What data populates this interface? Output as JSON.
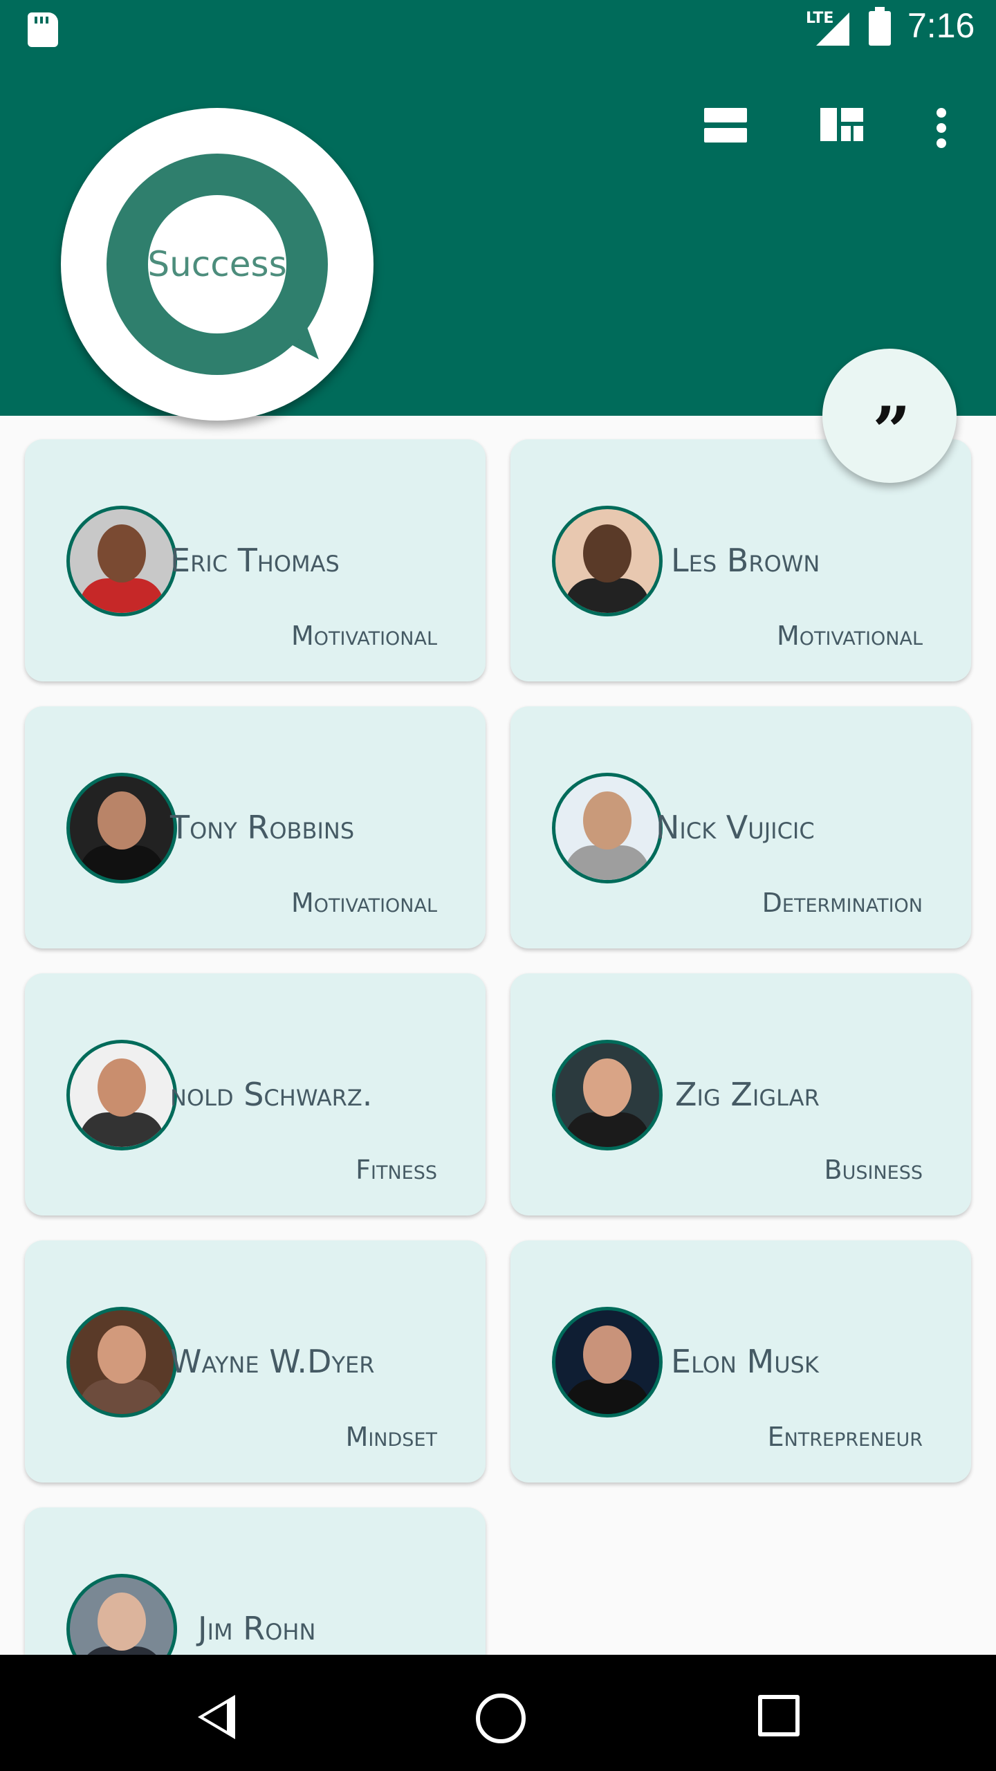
{
  "status_bar": {
    "network": "LTE",
    "time": "7:16",
    "icons": [
      "sd-card-icon",
      "signal-icon",
      "battery-charging-icon"
    ]
  },
  "app_bar": {
    "logo_text": "Success",
    "actions": [
      "list-view-icon",
      "grid-view-icon",
      "more-options-icon"
    ]
  },
  "fab": {
    "icon": "quote-icon",
    "glyph": "❞"
  },
  "colors": {
    "primary": "#006b5a",
    "card": "#e0f2f1",
    "text": "#455a64"
  },
  "speakers": [
    {
      "name": "Eric Thomas",
      "category": "Motivational"
    },
    {
      "name": "Les Brown",
      "category": "Motivational"
    },
    {
      "name": "Tony Robbins",
      "category": "Motivational"
    },
    {
      "name": "Nick Vujicic",
      "category": "Determination"
    },
    {
      "name": "nold Schwarz.",
      "category": "Fitness"
    },
    {
      "name": "Zig Ziglar",
      "category": "Business"
    },
    {
      "name": "Wayne W.Dyer",
      "category": "Mindset"
    },
    {
      "name": "Elon Musk",
      "category": "Entrepreneur"
    },
    {
      "name": "Jim Rohn",
      "category": ""
    }
  ],
  "nav_bar": [
    "back-icon",
    "home-icon",
    "recents-icon"
  ]
}
